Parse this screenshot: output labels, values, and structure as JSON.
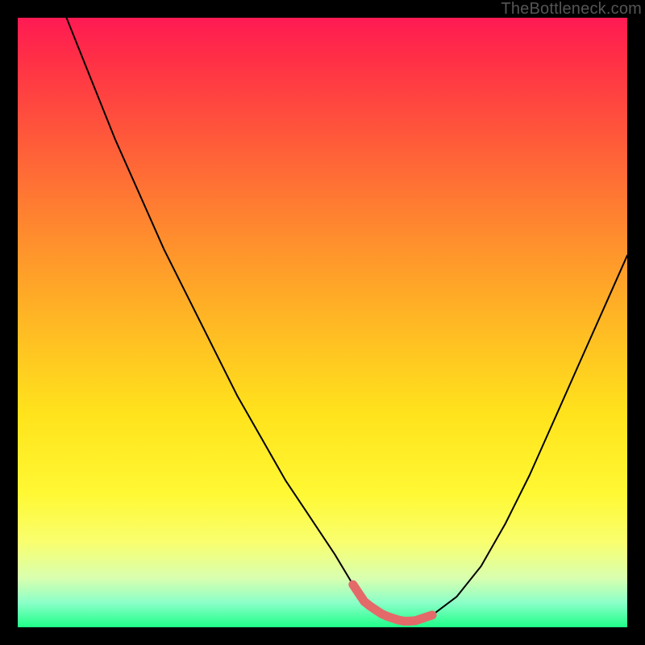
{
  "watermark": "TheBottleneck.com",
  "chart_data": {
    "type": "line",
    "title": "",
    "xlabel": "",
    "ylabel": "",
    "xlim": [
      0,
      100
    ],
    "ylim": [
      0,
      100
    ],
    "series": [
      {
        "name": "bottleneck-curve",
        "x": [
          8,
          12,
          16,
          20,
          24,
          28,
          32,
          36,
          40,
          44,
          48,
          52,
          55,
          57,
          60,
          63,
          65,
          68,
          72,
          76,
          80,
          84,
          88,
          92,
          96,
          100
        ],
        "values": [
          100,
          90,
          80,
          71,
          62,
          54,
          46,
          38,
          31,
          24,
          18,
          12,
          7,
          4,
          2,
          1,
          1,
          2,
          5,
          10,
          17,
          25,
          34,
          43,
          52,
          61
        ]
      }
    ],
    "bottom_marker": {
      "name": "optimal-range",
      "x_start": 55,
      "x_end": 68,
      "y": 2
    },
    "background_gradient": {
      "top": "#ff1a53",
      "mid": "#ffe31c",
      "bottom": "#1eff88"
    }
  }
}
